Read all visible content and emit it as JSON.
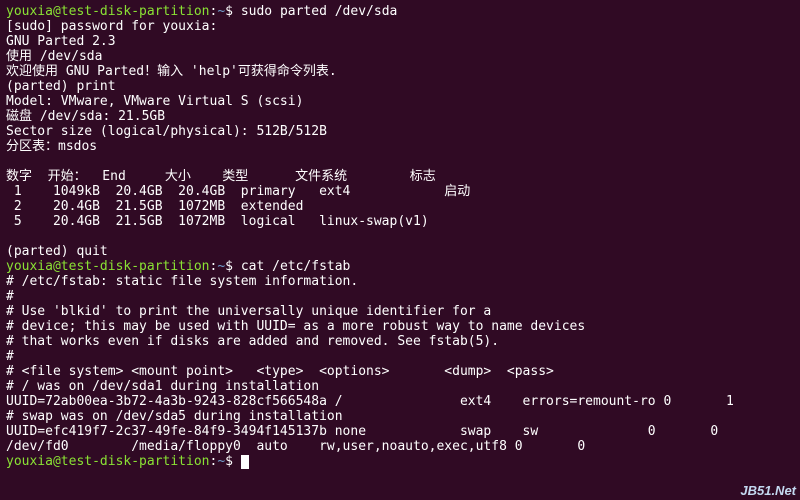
{
  "prompt": {
    "user_host": "youxia@test-disk-partition",
    "sep": ":",
    "path": "~",
    "dollar": "$"
  },
  "lines": {
    "l0_cmd": "sudo parted /dev/sda",
    "l1": "[sudo] password for youxia:",
    "l2": "GNU Parted 2.3",
    "l3": "使用 /dev/sda",
    "l4": "欢迎使用 GNU Parted！输入 'help'可获得命令列表.",
    "l5": "(parted) print",
    "l6": "Model: VMware, VMware Virtual S (scsi)",
    "l7": "磁盘 /dev/sda: 21.5GB",
    "l8": "Sector size (logical/physical): 512B/512B",
    "l9": "分区表：msdos",
    "l10": "",
    "l11": "数字  开始：  End     大小    类型      文件系统        标志",
    "l12": " 1    1049kB  20.4GB  20.4GB  primary   ext4            启动",
    "l13": " 2    20.4GB  21.5GB  1072MB  extended",
    "l14": " 5    20.4GB  21.5GB  1072MB  logical   linux-swap(v1)",
    "l15": "",
    "l16": "(parted) quit",
    "l17_cmd": "cat /etc/fstab",
    "l18": "# /etc/fstab: static file system information.",
    "l19": "#",
    "l20": "# Use 'blkid' to print the universally unique identifier for a",
    "l21": "# device; this may be used with UUID= as a more robust way to name devices",
    "l22": "# that works even if disks are added and removed. See fstab(5).",
    "l23": "#",
    "l24": "# <file system> <mount point>   <type>  <options>       <dump>  <pass>",
    "l25": "# / was on /dev/sda1 during installation",
    "l26": "UUID=72ab00ea-3b72-4a3b-9243-828cf566548a /               ext4    errors=remount-ro 0       1",
    "l27": "# swap was on /dev/sda5 during installation",
    "l28": "UUID=efc419f7-2c37-49fe-84f9-3494f145137b none            swap    sw              0       0",
    "l29": "/dev/fd0        /media/floppy0  auto    rw,user,noauto,exec,utf8 0       0"
  },
  "footer": "JB51.Net"
}
